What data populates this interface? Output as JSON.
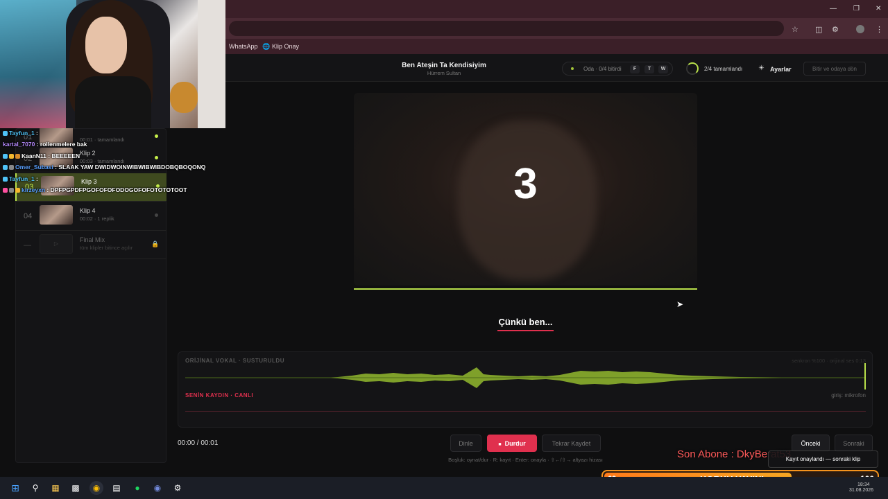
{
  "browser": {
    "bookmarks": [
      {
        "label": "WhatsApp"
      },
      {
        "label": "Klip Onay"
      }
    ]
  },
  "header": {
    "song_title": "Ben Ateşin Ta Kendisiyim",
    "song_artist": "Hürrem Sultan",
    "room_label": "Oda · 0/4 bitirdi",
    "keys": [
      "F",
      "T",
      "W"
    ],
    "progress_label": "2/4 tamamlandı",
    "settings_label": "Ayarlar",
    "finish_label": "Bitir ve odaya dön"
  },
  "clips": [
    {
      "num": "01",
      "name": "",
      "meta": "00:01 · tamamlandı",
      "state": "done"
    },
    {
      "num": "02",
      "name": "Klip 2",
      "meta": "00:03 · tamamlandı",
      "state": "done"
    },
    {
      "num": "03",
      "name": "Klip 3",
      "meta": "",
      "state": "active"
    },
    {
      "num": "04",
      "name": "Klip 4",
      "meta": "00:02 · 1 replik",
      "state": "pending"
    },
    {
      "num": "—",
      "name": "Final Mix",
      "meta": "tüm klipler bitince açılır",
      "state": "locked"
    }
  ],
  "chat": [
    {
      "user": "Tayfun_1",
      "msg": "",
      "color": "cyan"
    },
    {
      "user": "kartal_7070",
      "msg": "rollenmelere bak",
      "color": "purple"
    },
    {
      "user": "KaanN11",
      "msg": "BEEEEEN",
      "color": "white"
    },
    {
      "user": "Omer_Subasi",
      "msg": "SLAAK YAW DWIDWOINWIBWIBWIBDOBQBOQONQ",
      "color": "blue"
    },
    {
      "user": "Tayfun_1",
      "msg": "",
      "color": "cyan"
    },
    {
      "user": "kirzeyxn",
      "msg": "DPFPGPDFPGOFOFOFODOGOFOFOTOTOTOOT",
      "color": "blue"
    }
  ],
  "player": {
    "countdown": "3",
    "lyric": "Çünkü ben...",
    "original_label": "ORİJİNAL VOKAL · SUSTURULDU",
    "original_meta": "senkron %100 · orijinal ses 0:13",
    "your_label": "SENİN KAYDIN · CANLI",
    "your_meta": "giriş: mikrofon",
    "time": "00:00 / 00:01",
    "progress": 1.0
  },
  "controls": {
    "listen": "Dinle",
    "stop": "Durdur",
    "rerecord": "Tekrar Kaydet",
    "prev": "Önceki",
    "next": "Sonraki",
    "hint": "Boşluk: oynat/dur · R: kayıt · Enter: onayla · ⇧←/⇧→ altyazı hizası"
  },
  "overlay": {
    "last_sub": "Son Abone : DkyBerat53",
    "toast": "Kayıt onaylandı — sonraki klip",
    "korku_left": "69",
    "korku_title": "KORKU YAYINI",
    "korku_right": "100"
  },
  "taskbar": {
    "time": "18:34",
    "date": "31.08.2026"
  },
  "colors": {
    "accent": "#b8e04a",
    "record": "#e0304e",
    "bg": "#0f0f10"
  }
}
